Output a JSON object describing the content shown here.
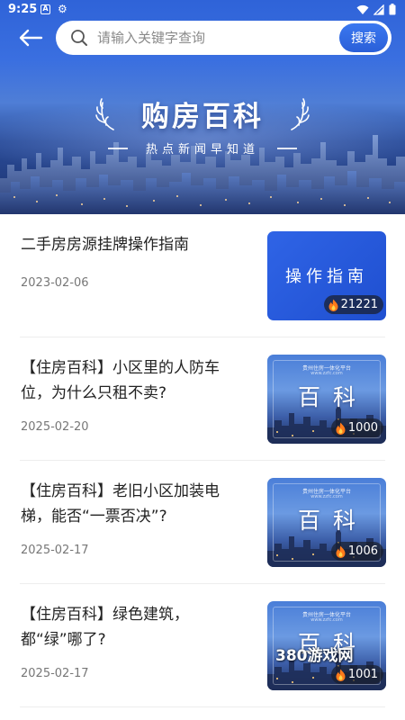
{
  "status_bar": {
    "time": "9:25",
    "app_icon_letter": "A"
  },
  "search": {
    "placeholder": "请输入关键字查询",
    "value": "",
    "button_label": "搜索"
  },
  "hero": {
    "title": "购房百科",
    "subtitle": "热点新闻早知道"
  },
  "articles": [
    {
      "title": "二手房房源挂牌操作指南",
      "date": "2023-02-06",
      "thumbnail_text": "操作指南",
      "views": "21221"
    },
    {
      "title": "【住房百科】小区里的人防车位，为什么只租不卖?",
      "date": "2025-02-20",
      "thumbnail_text": "百科",
      "thumbnail_caption": "贵州住房一体化平台",
      "thumbnail_caption2": "www.zzfc.com",
      "views": "1000"
    },
    {
      "title": "【住房百科】老旧小区加装电梯，能否“一票否决”?",
      "date": "2025-02-17",
      "thumbnail_text": "百科",
      "thumbnail_caption": "贵州住房一体化平台",
      "thumbnail_caption2": "www.zzfc.com",
      "views": "1006"
    },
    {
      "title": "【住房百科】绿色建筑，都“绿”哪了?",
      "date": "2025-02-17",
      "thumbnail_text": "百科",
      "thumbnail_caption": "贵州住房一体化平台",
      "thumbnail_caption2": "www.zzfc.com",
      "views": "1001"
    }
  ],
  "watermark": "380游戏网",
  "colors": {
    "accent": "#2f64e6",
    "hero_top": "#2f63d8",
    "hero_bottom": "#1a2f6a",
    "divider": "#ededed",
    "date_text": "#777777"
  },
  "icons": {
    "back": "arrow-left-icon",
    "search": "search-icon",
    "views": "fire-icon",
    "settings": "gear-icon",
    "wifi": "wifi-icon",
    "battery": "battery-icon",
    "signal": "signal-icon"
  }
}
